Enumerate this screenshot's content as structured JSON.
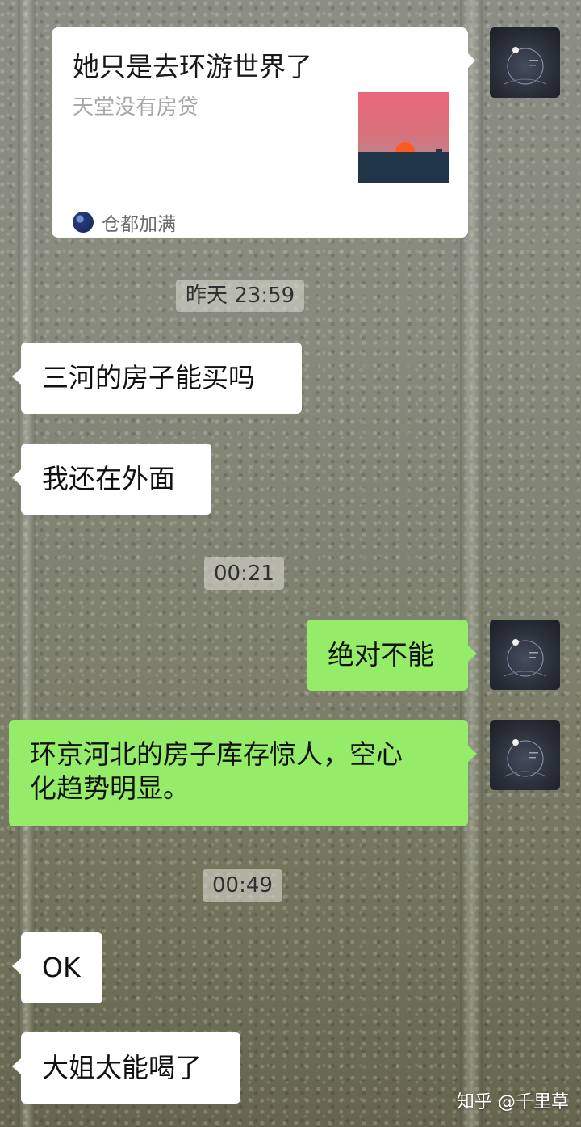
{
  "link_card": {
    "title": "她只是去环游世界了",
    "subtitle": "天堂没有房贷",
    "source_name": "仓都加满"
  },
  "messages": [
    {
      "type": "timestamp",
      "text": "昨天 23:59"
    },
    {
      "type": "received",
      "text": "三河的房子能买吗"
    },
    {
      "type": "received",
      "text": "我还在外面"
    },
    {
      "type": "timestamp",
      "text": "00:21"
    },
    {
      "type": "sent",
      "text": "绝对不能"
    },
    {
      "type": "sent",
      "lines": [
        "环京河北的房子库存惊人，空心",
        "化趋势明显。"
      ]
    },
    {
      "type": "timestamp",
      "text": "00:49"
    },
    {
      "type": "received",
      "text": "OK"
    },
    {
      "type": "received",
      "text": "大姐太能喝了"
    }
  ],
  "watermark": "知乎 @千里草",
  "colors": {
    "sent_bubble": "#95ec69",
    "received_bubble": "#ffffff"
  },
  "icons": {
    "avatar": "self-avatar-icon",
    "source": "source-account-icon"
  }
}
